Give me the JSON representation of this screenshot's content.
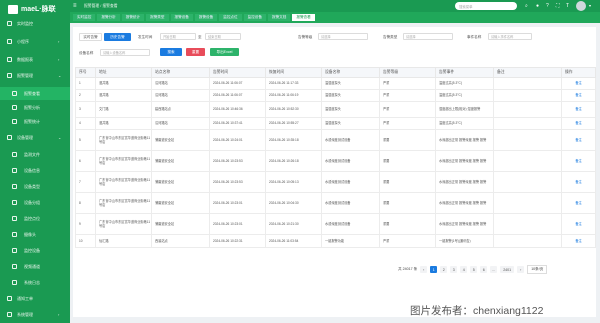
{
  "brand": {
    "name": "maeL·脉联"
  },
  "sidebar": {
    "items": [
      {
        "label": "实时监控",
        "arrow": ""
      },
      {
        "label": "小程序",
        "arrow": "›"
      },
      {
        "label": "数据报表",
        "arrow": "›"
      },
      {
        "label": "报警管理",
        "arrow": "⌄"
      },
      {
        "label": "报警查看",
        "arrow": ""
      },
      {
        "label": "报警分析",
        "arrow": ""
      },
      {
        "label": "报警统计",
        "arrow": ""
      },
      {
        "label": "设备管理",
        "arrow": "⌄"
      },
      {
        "label": "监测文件",
        "arrow": ""
      },
      {
        "label": "设备信息",
        "arrow": ""
      },
      {
        "label": "设备类型",
        "arrow": ""
      },
      {
        "label": "设备分组",
        "arrow": ""
      },
      {
        "label": "监控点位",
        "arrow": ""
      },
      {
        "label": "摄像头",
        "arrow": ""
      },
      {
        "label": "监控设备",
        "arrow": ""
      },
      {
        "label": "视频通道",
        "arrow": ""
      },
      {
        "label": "系统日志",
        "arrow": ""
      },
      {
        "label": "通知工单",
        "arrow": ""
      },
      {
        "label": "系统管理",
        "arrow": "›"
      }
    ]
  },
  "header": {
    "breadcrumb": "报警管理 / 报警查看",
    "search_placeholder": "搜索菜单"
  },
  "tabs": [
    "实时监控",
    "报警分析",
    "报警统计",
    "报警类型",
    "报警设备",
    "报警设备",
    "监控点位",
    "监控设备",
    "报警文档",
    "报警查看"
  ],
  "toolbar": {
    "realtime": "实时告警",
    "history": "历史告警",
    "time_label": "发生时间",
    "start_placeholder": "开始日期",
    "to": "至",
    "end_placeholder": "结束日期",
    "level_label": "告警等级",
    "level_placeholder": "请选择",
    "type_label": "告警类型",
    "type_placeholder": "请选择",
    "event_label": "事件名称",
    "event_placeholder": "请输入事件名称",
    "device_label": "设备名称",
    "device_placeholder": "请输入设备名称",
    "search": "搜索",
    "reset": "重置",
    "export": "导出Excel"
  },
  "table": {
    "headers": [
      "序号",
      "地址",
      "站点名称",
      "告警时间",
      "恢复时间",
      "设备名称",
      "告警等级",
      "告警事件",
      "备注",
      "操作"
    ],
    "rows": [
      [
        "1",
        "漫井路",
        "沿河路站",
        "2024-06-26 11:06:07",
        "2024-06-26 11:17:33",
        "温湿度探头",
        "严重",
        "温度过高(5.3°C)",
        "",
        "备注"
      ],
      [
        "2",
        "漫井路",
        "沿河路站",
        "2024-06-26 11:06:07",
        "2024-06-26 11:06:19",
        "温湿度探头",
        "严重",
        "温度过高(5.3°C)",
        "",
        "备注"
      ],
      [
        "3",
        "文门路",
        "建西路站点",
        "2024-06-26 10:46:36",
        "2024-06-26 10:52:30",
        "温湿度探头",
        "严重",
        "湿度超出上限(相对) 湿度报警",
        "",
        "备注"
      ],
      [
        "4",
        "漫井路",
        "沿河路站",
        "2024-06-26 10:37:41",
        "2024-06-26 10:55:27",
        "温湿度探头",
        "严重",
        "温度过高(5.3°C)",
        "",
        "备注"
      ],
      [
        "5",
        "广东省中山市东区富华道商业街巷11号店",
        "蒲磨道安全站",
        "2024-06-26 10:24:01",
        "2024-06-26 10:35:18",
        "水浸深度测试设备",
        "重要",
        "水深超出正常 报警深度 报警 报警",
        "",
        "备注"
      ],
      [
        "6",
        "广东省中山市东区富华道商业街巷11号店",
        "蒲磨道安全站",
        "2024-06-26 10:23:53",
        "2024-06-26 10:26:18",
        "水浸深度测试设备",
        "重要",
        "水深超出正常 报警深度 报警 报警",
        "",
        "备注"
      ],
      [
        "7",
        "广东省中山市东区富华道商业街巷11号店",
        "蒲磨道安全站",
        "2024-06-26 10:23:53",
        "2024-06-26 10:05:13",
        "水浸深度测试设备",
        "重要",
        "水深超出正常 报警深度 报警 报警",
        "",
        "备注"
      ],
      [
        "8",
        "广东省中山市东区富华道商业街巷11号店",
        "蒲磨道安全站",
        "2024-06-26 10:23:01",
        "2024-06-26 10:04:30",
        "水浸深度测试设备",
        "重要",
        "水深超出正常 报警深度 报警 报警",
        "",
        "备注"
      ],
      [
        "9",
        "广东省中山市东区富华道商业街巷11号店",
        "蒲磨道安全站",
        "2024-06-26 10:23:01",
        "2024-06-26 10:21:30",
        "水浸深度测试设备",
        "重要",
        "水深超出正常 报警深度 报警 报警",
        "",
        "备注"
      ],
      [
        "10",
        "仙汇路",
        "西溪站点",
        "2024-06-26 10:22:31",
        "2024-06-26 11:03:54",
        "一键报警功能",
        "严重",
        "一键报警(1号)(通讯告)",
        "",
        "备注"
      ]
    ]
  },
  "pager": {
    "total": "共 24017 条",
    "pages": [
      "1",
      "2",
      "3",
      "4",
      "5",
      "6",
      "...",
      "2401"
    ],
    "prev": "‹",
    "next": "›",
    "page_size": "10条/页"
  },
  "watermark": "图片发布者：chenxiang1122"
}
